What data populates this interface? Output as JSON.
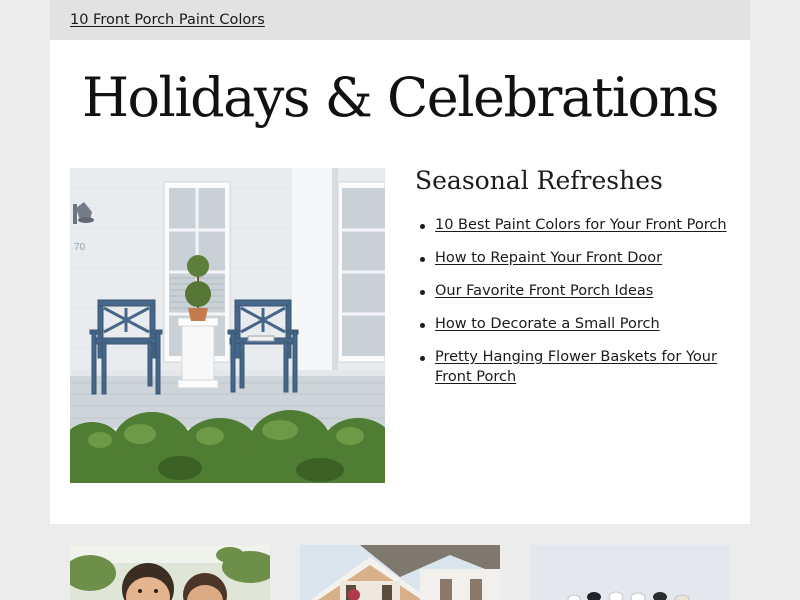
{
  "topbar": {
    "link": "10 Front Porch Paint Colors"
  },
  "headline": "Holidays & Celebrations",
  "hero": {
    "house_number": "70"
  },
  "sidebar": {
    "title": "Seasonal Refreshes",
    "links": [
      "10 Best Paint Colors for Your Front Porch",
      "How to Repaint Your Front Door",
      "Our Favorite Front Porch Ideas",
      "How to Decorate a Small Porch",
      "Pretty Hanging Flower Baskets for Your Front Porch"
    ]
  },
  "colors": {
    "page_bg": "#ececec",
    "topbar_bg": "#e2e2e2",
    "panel_bg": "#ffffff",
    "chair_blue": "#47678a",
    "shrub_green": "#4f7d33"
  }
}
